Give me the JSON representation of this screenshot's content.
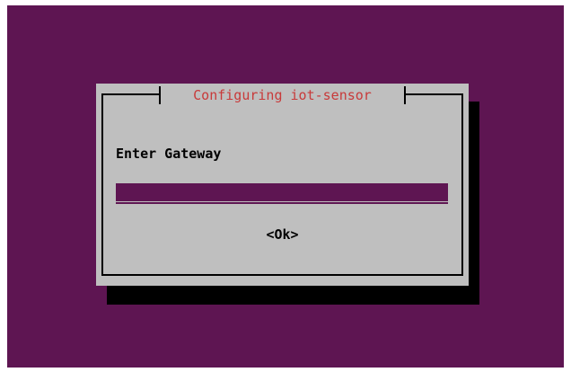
{
  "dialog": {
    "title": "Configuring iot-sensor",
    "prompt": "Enter Gateway",
    "input_value": "",
    "ok_label": "<Ok>"
  },
  "colors": {
    "background": "#5e1552",
    "dialog": "#bfbfbf",
    "title": "#c83a3a",
    "shadow": "#000000"
  }
}
